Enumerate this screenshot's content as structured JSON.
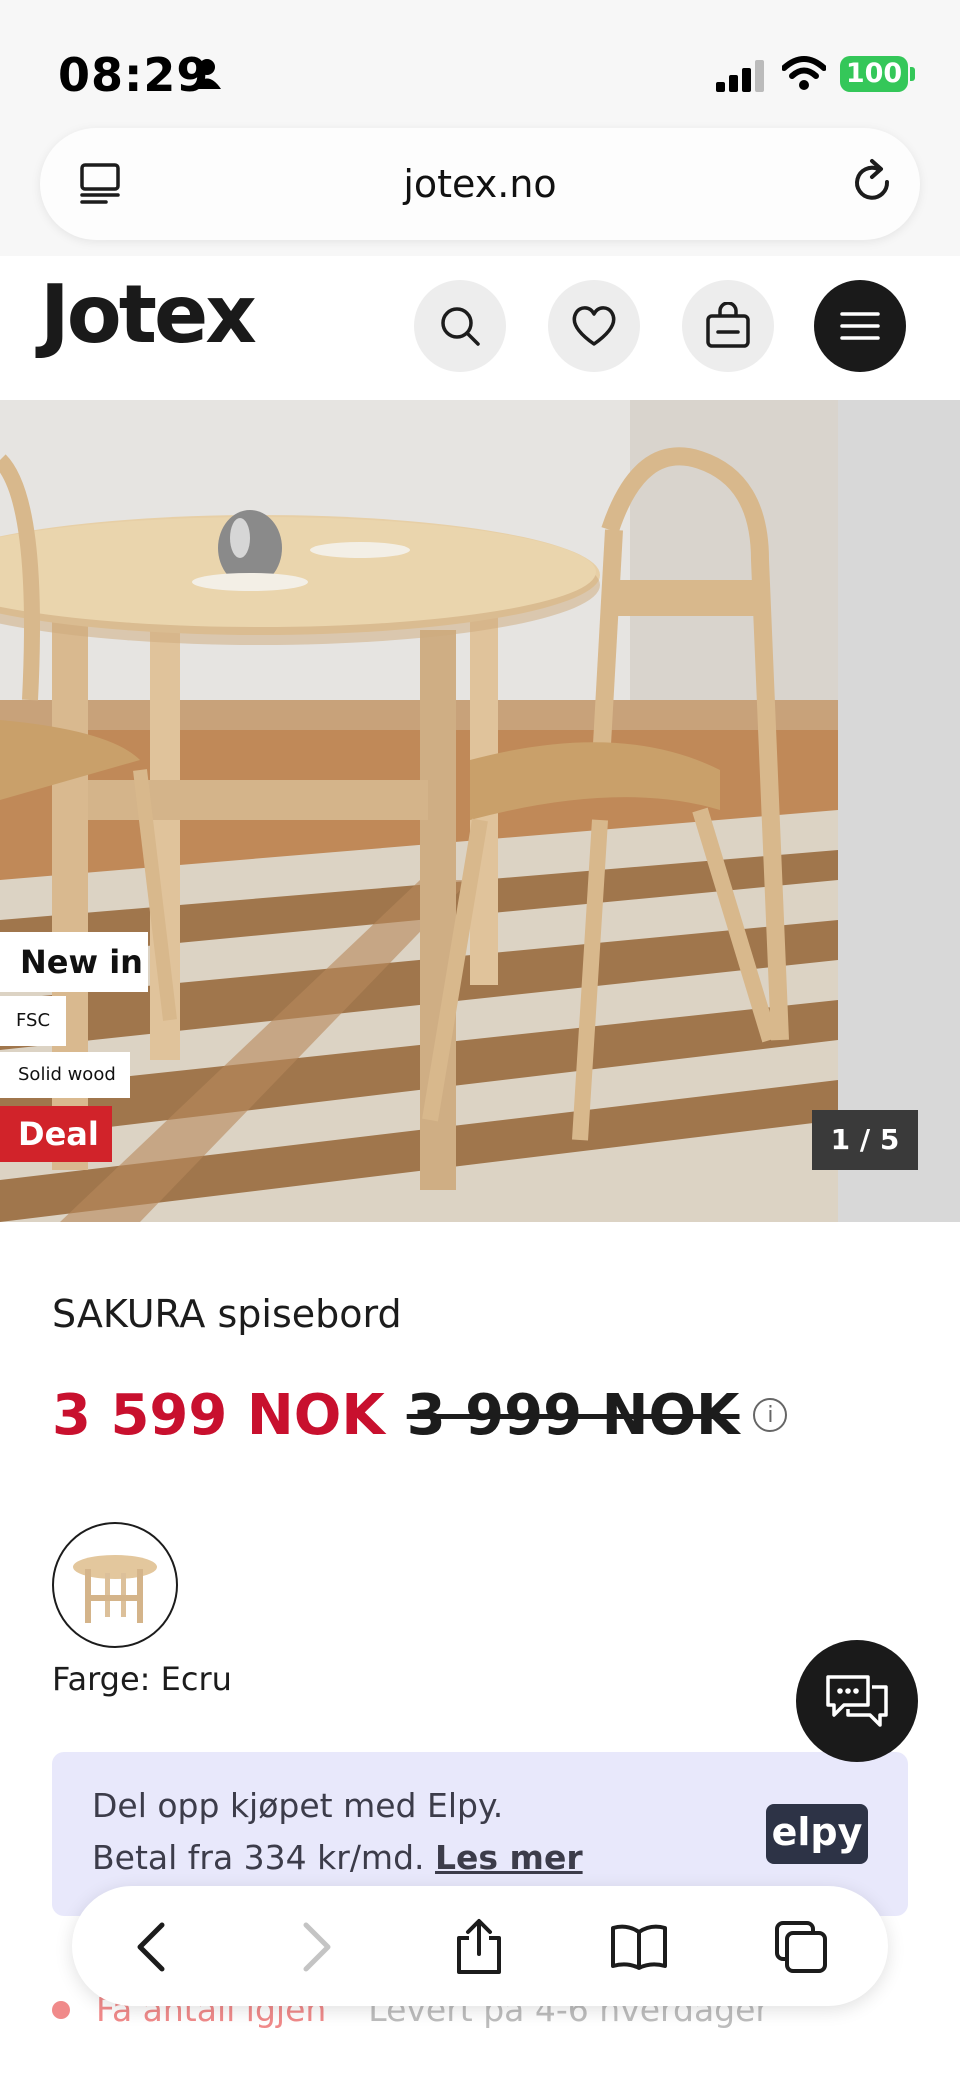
{
  "status_bar": {
    "time": "08:29",
    "battery": "100"
  },
  "browser": {
    "url": "jotex.no"
  },
  "site": {
    "logo": "Jotex"
  },
  "gallery": {
    "badges": {
      "new_in": "New in",
      "fsc": "FSC",
      "solid_wood": "Solid wood",
      "deal": "Deal"
    },
    "counter": "1 / 5"
  },
  "product": {
    "name": "SAKURA spisebord",
    "price_sale": "3 599 NOK",
    "price_original": "3 999 NOK",
    "colour_label": "Farge: Ecru"
  },
  "elpy": {
    "line1": "Del opp kjøpet med Elpy.",
    "line2_prefix": "Betal fra 334 kr/md.",
    "link": "Les mer",
    "logo": "elpy"
  },
  "stock": {
    "status": "Få antall igjen",
    "delivery": "Levert på 4-6 hverdager"
  },
  "colors": {
    "sale": "#c8102e",
    "deal_badge": "#d1232a",
    "battery": "#34c759",
    "elpy_bg": "#e8e8fb"
  }
}
